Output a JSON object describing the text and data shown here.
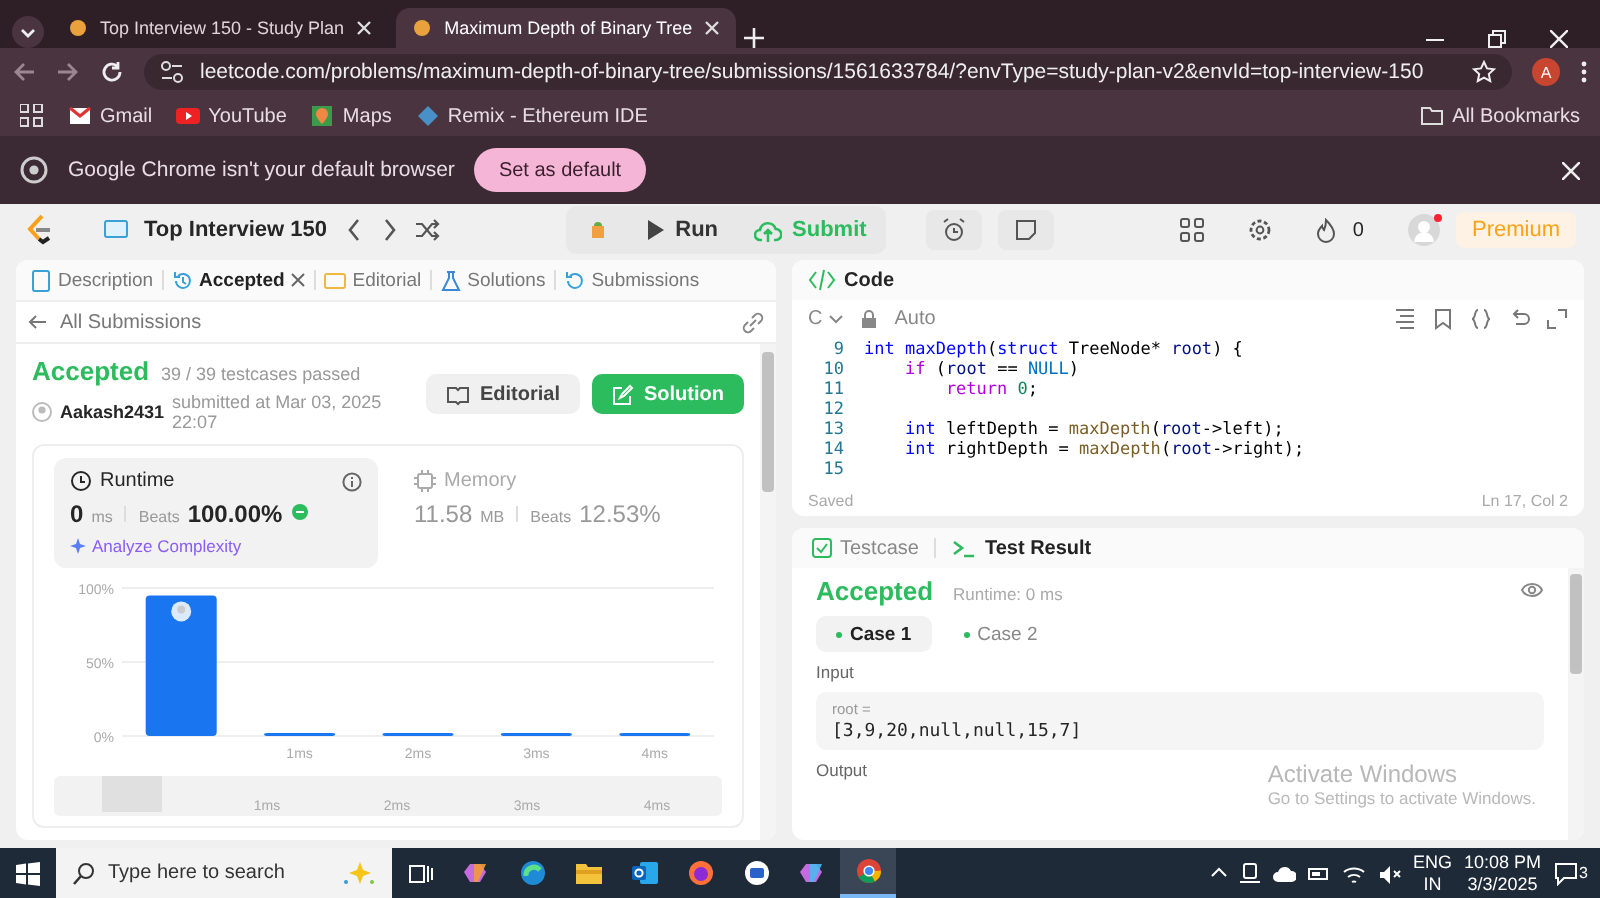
{
  "browser": {
    "tabs": [
      {
        "title": "Top Interview 150 - Study Plan",
        "selected": false
      },
      {
        "title": "Maximum Depth of Binary Tree",
        "selected": true
      }
    ],
    "url": "leetcode.com/problems/maximum-depth-of-binary-tree/submissions/1561633784/?envType=study-plan-v2&envId=top-interview-150",
    "profile_initial": "A",
    "bookmarks": [
      "Gmail",
      "YouTube",
      "Maps",
      "Remix - Ethereum IDE"
    ],
    "all_bookmarks": "All Bookmarks",
    "infobar": {
      "message": "Google Chrome isn't your default browser",
      "button": "Set as default"
    }
  },
  "header": {
    "study_plan": "Top Interview 150",
    "run": "Run",
    "submit": "Submit",
    "streak": "0",
    "premium": "Premium"
  },
  "submission_panel": {
    "tabs": [
      {
        "label": "Description",
        "selected": false
      },
      {
        "label": "Accepted",
        "selected": true
      },
      {
        "label": "Editorial",
        "selected": false
      },
      {
        "label": "Solutions",
        "selected": false
      },
      {
        "label": "Submissions",
        "selected": false
      }
    ],
    "back_link": "All Submissions",
    "status": "Accepted",
    "testcases": "39 / 39 testcases passed",
    "user": "Aakash2431",
    "submitted": "submitted at Mar 03, 2025 22:07",
    "editorial_button": "Editorial",
    "solution_button": "Solution",
    "metrics": [
      {
        "kind": "runtime",
        "label": "Runtime",
        "value": "0",
        "unit": "ms",
        "beats_label": "Beats",
        "beats": "100.00%",
        "selected": true
      },
      {
        "kind": "memory",
        "label": "Memory",
        "value": "11.58",
        "unit": "MB",
        "beats_label": "Beats",
        "beats": "12.53%",
        "selected": false
      }
    ],
    "analyze": "Analyze Complexity",
    "chart_data": {
      "type": "bar",
      "categories": [
        null,
        "1ms",
        "2ms",
        "3ms",
        "4ms"
      ],
      "values": [
        95,
        2,
        2,
        2,
        2
      ],
      "ylim": [
        0,
        100
      ],
      "yticks": [
        {
          "value": 0,
          "label": "0%"
        },
        {
          "value": 50,
          "label": "50%"
        },
        {
          "value": 100,
          "label": "100%"
        }
      ]
    },
    "overview_labels": [
      "1ms",
      "2ms",
      "3ms",
      "4ms"
    ]
  },
  "code_panel": {
    "title": "Code",
    "language": "C",
    "mode": "Auto",
    "lines": [
      {
        "number": "9",
        "tokens": [
          {
            "text": "int ",
            "kind": "type"
          },
          {
            "text": "maxDepth",
            "kind": "decl"
          },
          {
            "text": "(",
            "kind": "plain"
          },
          {
            "text": "struct",
            "kind": "type"
          },
          {
            "text": " TreeNode* ",
            "kind": "plain"
          },
          {
            "text": "root",
            "kind": "var"
          },
          {
            "text": ") {",
            "kind": "plain"
          }
        ]
      },
      {
        "number": "10",
        "tokens": [
          {
            "text": "    if",
            "kind": "control"
          },
          {
            "text": " (",
            "kind": "plain"
          },
          {
            "text": "root",
            "kind": "var"
          },
          {
            "text": " == ",
            "kind": "plain"
          },
          {
            "text": "NULL",
            "kind": "const"
          },
          {
            "text": ")",
            "kind": "plain"
          }
        ]
      },
      {
        "number": "11",
        "tokens": [
          {
            "text": "        return ",
            "kind": "control"
          },
          {
            "text": "0",
            "kind": "number"
          },
          {
            "text": ";",
            "kind": "plain"
          }
        ]
      },
      {
        "number": "12"
      },
      {
        "number": "13",
        "tokens": [
          {
            "text": "    int",
            "kind": "type"
          },
          {
            "text": " leftDepth = ",
            "kind": "plain"
          },
          {
            "text": "maxDepth",
            "kind": "call"
          },
          {
            "text": "(",
            "kind": "plain"
          },
          {
            "text": "root",
            "kind": "var"
          },
          {
            "text": "->left);",
            "kind": "plain"
          }
        ]
      },
      {
        "number": "14",
        "tokens": [
          {
            "text": "    int",
            "kind": "type"
          },
          {
            "text": " rightDepth = ",
            "kind": "plain"
          },
          {
            "text": "maxDepth",
            "kind": "call"
          },
          {
            "text": "(",
            "kind": "plain"
          },
          {
            "text": "root",
            "kind": "var"
          },
          {
            "text": "->right);",
            "kind": "plain"
          }
        ]
      },
      {
        "number": "15"
      }
    ],
    "status": "Saved",
    "cursor": "Ln 17, Col 2"
  },
  "result_panel": {
    "tabs": [
      {
        "label": "Testcase",
        "selected": false
      },
      {
        "label": "Test Result",
        "selected": true
      }
    ],
    "status": "Accepted",
    "runtime": "Runtime: 0 ms",
    "cases": [
      {
        "label": "Case 1",
        "selected": true
      },
      {
        "label": "Case 2",
        "selected": false
      }
    ],
    "input_label": "Input",
    "input_name": "root =",
    "input_value": "[3,9,20,null,null,15,7]",
    "output_label": "Output",
    "activation_notice": {
      "title": "Activate Windows",
      "message": "Go to Settings to activate Windows."
    }
  },
  "taskbar": {
    "search_placeholder": "Type here to search",
    "language": "ENG",
    "region": "IN",
    "time": "10:08 PM",
    "date": "3/3/2025",
    "notifications": "3"
  }
}
